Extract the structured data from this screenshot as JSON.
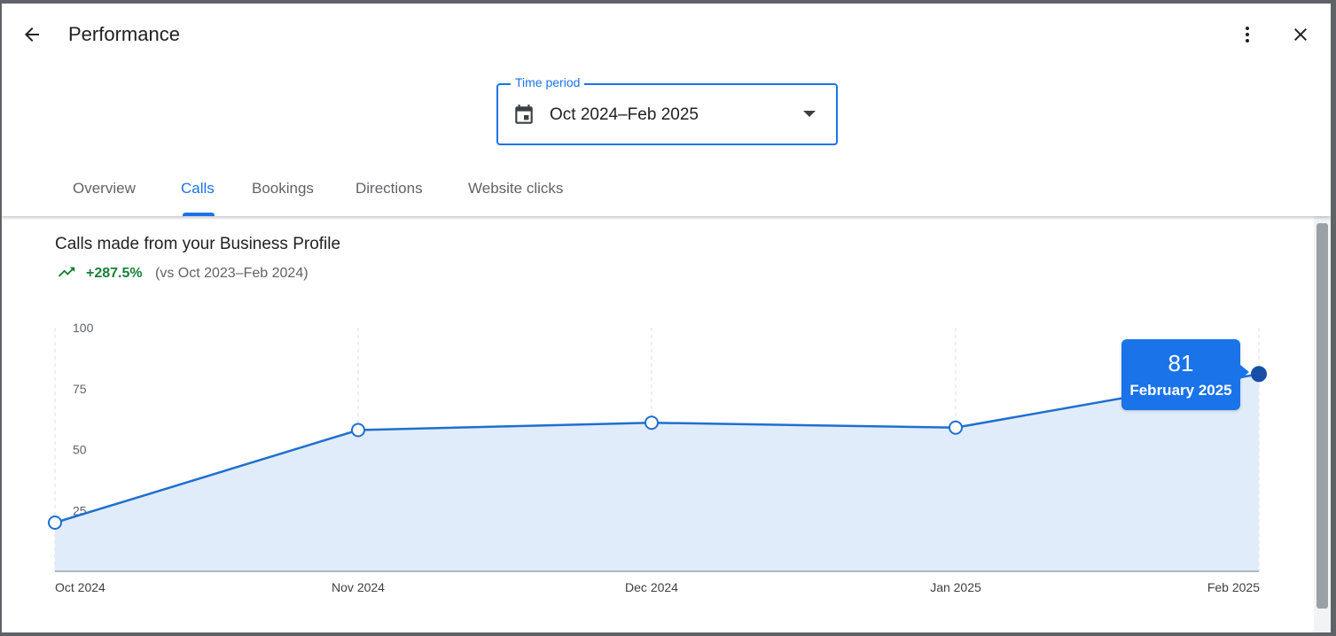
{
  "header": {
    "title": "Performance",
    "back_icon": "arrow-back-icon",
    "more_icon": "more-vert-icon",
    "close_icon": "close-icon"
  },
  "time_period": {
    "label": "Time period",
    "value": "Oct 2024–Feb 2025",
    "icon": "calendar-icon"
  },
  "tabs": [
    {
      "label": "Overview",
      "active": false
    },
    {
      "label": "Calls",
      "active": true
    },
    {
      "label": "Bookings",
      "active": false
    },
    {
      "label": "Directions",
      "active": false
    },
    {
      "label": "Website clicks",
      "active": false
    }
  ],
  "chart_header": {
    "title": "Calls made from your Business Profile",
    "change": "+287.5%",
    "compare": "(vs Oct 2023–Feb 2024)",
    "trend_icon": "trending-up-icon"
  },
  "tooltip": {
    "value": "81",
    "label": "February 2025"
  },
  "colors": {
    "accent": "#1a73e8",
    "positive": "#188038",
    "line": "#1f6fd0",
    "area": "#e1ecfb"
  },
  "chart_data": {
    "type": "area",
    "categories": [
      "Oct 2024",
      "Nov 2024",
      "Dec 2024",
      "Jan 2025",
      "Feb 2025"
    ],
    "series": [
      {
        "values": [
          20,
          58,
          61,
          59,
          81
        ]
      }
    ],
    "yticks": [
      "100",
      "75",
      "50",
      "25"
    ],
    "ylim": [
      0,
      100
    ],
    "grid": "vertical dashed",
    "highlighted_point": 4
  }
}
